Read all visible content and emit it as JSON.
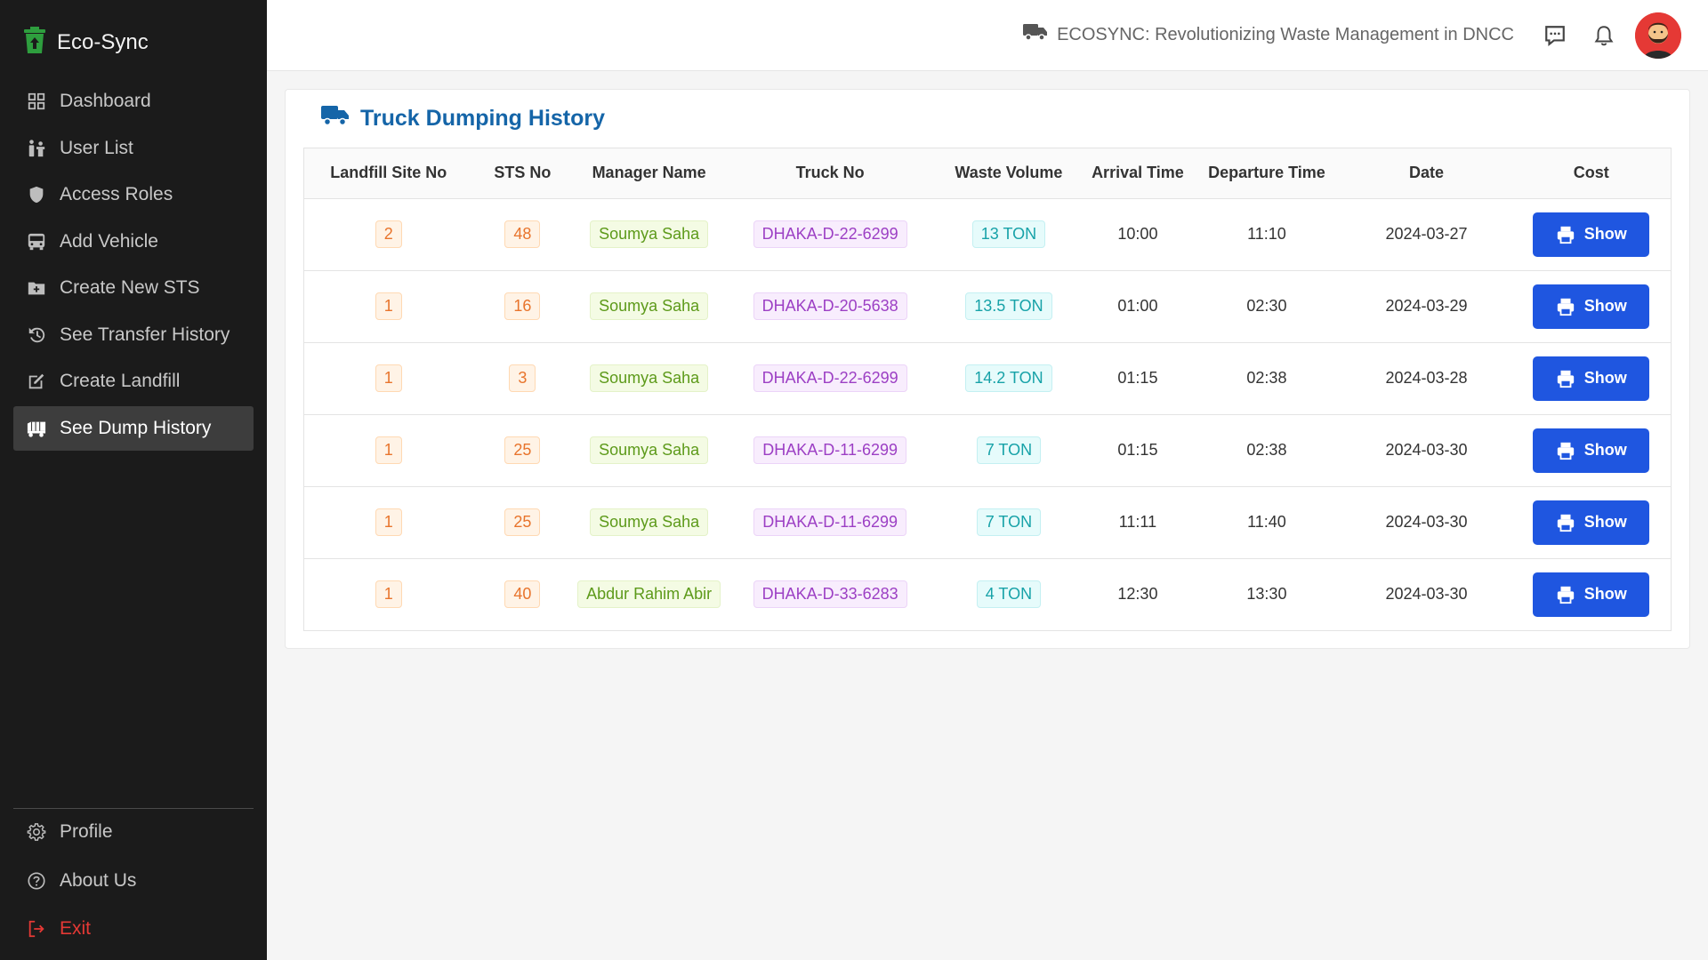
{
  "app": {
    "name": "Eco-Sync",
    "header_title": "ECOSYNC: Revolutionizing Waste Management in DNCC"
  },
  "sidebar": {
    "items": [
      {
        "label": "Dashboard",
        "icon": "grid-icon"
      },
      {
        "label": "User List",
        "icon": "users-icon"
      },
      {
        "label": "Access Roles",
        "icon": "shield-icon"
      },
      {
        "label": "Add Vehicle",
        "icon": "bus-icon"
      },
      {
        "label": "Create New STS",
        "icon": "folder-plus-icon"
      },
      {
        "label": "See Transfer History",
        "icon": "history-icon"
      },
      {
        "label": "Create Landfill",
        "icon": "edit-icon"
      },
      {
        "label": "See Dump History",
        "icon": "truck-icon",
        "active": true
      }
    ],
    "bottom_items": [
      {
        "label": "Profile",
        "icon": "gear-icon"
      },
      {
        "label": "About Us",
        "icon": "question-icon"
      },
      {
        "label": "Exit",
        "icon": "exit-icon"
      }
    ]
  },
  "page": {
    "title": "Truck Dumping History"
  },
  "table": {
    "columns": [
      "Landfill Site No",
      "STS No",
      "Manager Name",
      "Truck No",
      "Waste Volume",
      "Arrival Time",
      "Departure Time",
      "Date",
      "Cost"
    ],
    "action_label": "Show",
    "rows": [
      {
        "landfill": "2",
        "sts": "48",
        "manager": "Soumya Saha",
        "truck": "DHAKA-D-22-6299",
        "volume": "13 TON",
        "arrival": "10:00",
        "departure": "11:10",
        "date": "2024-03-27"
      },
      {
        "landfill": "1",
        "sts": "16",
        "manager": "Soumya Saha",
        "truck": "DHAKA-D-20-5638",
        "volume": "13.5 TON",
        "arrival": "01:00",
        "departure": "02:30",
        "date": "2024-03-29"
      },
      {
        "landfill": "1",
        "sts": "3",
        "manager": "Soumya Saha",
        "truck": "DHAKA-D-22-6299",
        "volume": "14.2 TON",
        "arrival": "01:15",
        "departure": "02:38",
        "date": "2024-03-28"
      },
      {
        "landfill": "1",
        "sts": "25",
        "manager": "Soumya Saha",
        "truck": "DHAKA-D-11-6299",
        "volume": "7 TON",
        "arrival": "01:15",
        "departure": "02:38",
        "date": "2024-03-30"
      },
      {
        "landfill": "1",
        "sts": "25",
        "manager": "Soumya Saha",
        "truck": "DHAKA-D-11-6299",
        "volume": "7 TON",
        "arrival": "11:11",
        "departure": "11:40",
        "date": "2024-03-30"
      },
      {
        "landfill": "1",
        "sts": "40",
        "manager": "Abdur Rahim Abir",
        "truck": "DHAKA-D-33-6283",
        "volume": "4 TON",
        "arrival": "12:30",
        "departure": "13:30",
        "date": "2024-03-30"
      }
    ]
  },
  "colors": {
    "sidebar_bg": "#1b1b1b",
    "accent_blue": "#1f56e0",
    "title_blue": "#1565a8",
    "brand_green": "#2e9e3e",
    "exit_red": "#e53935"
  }
}
